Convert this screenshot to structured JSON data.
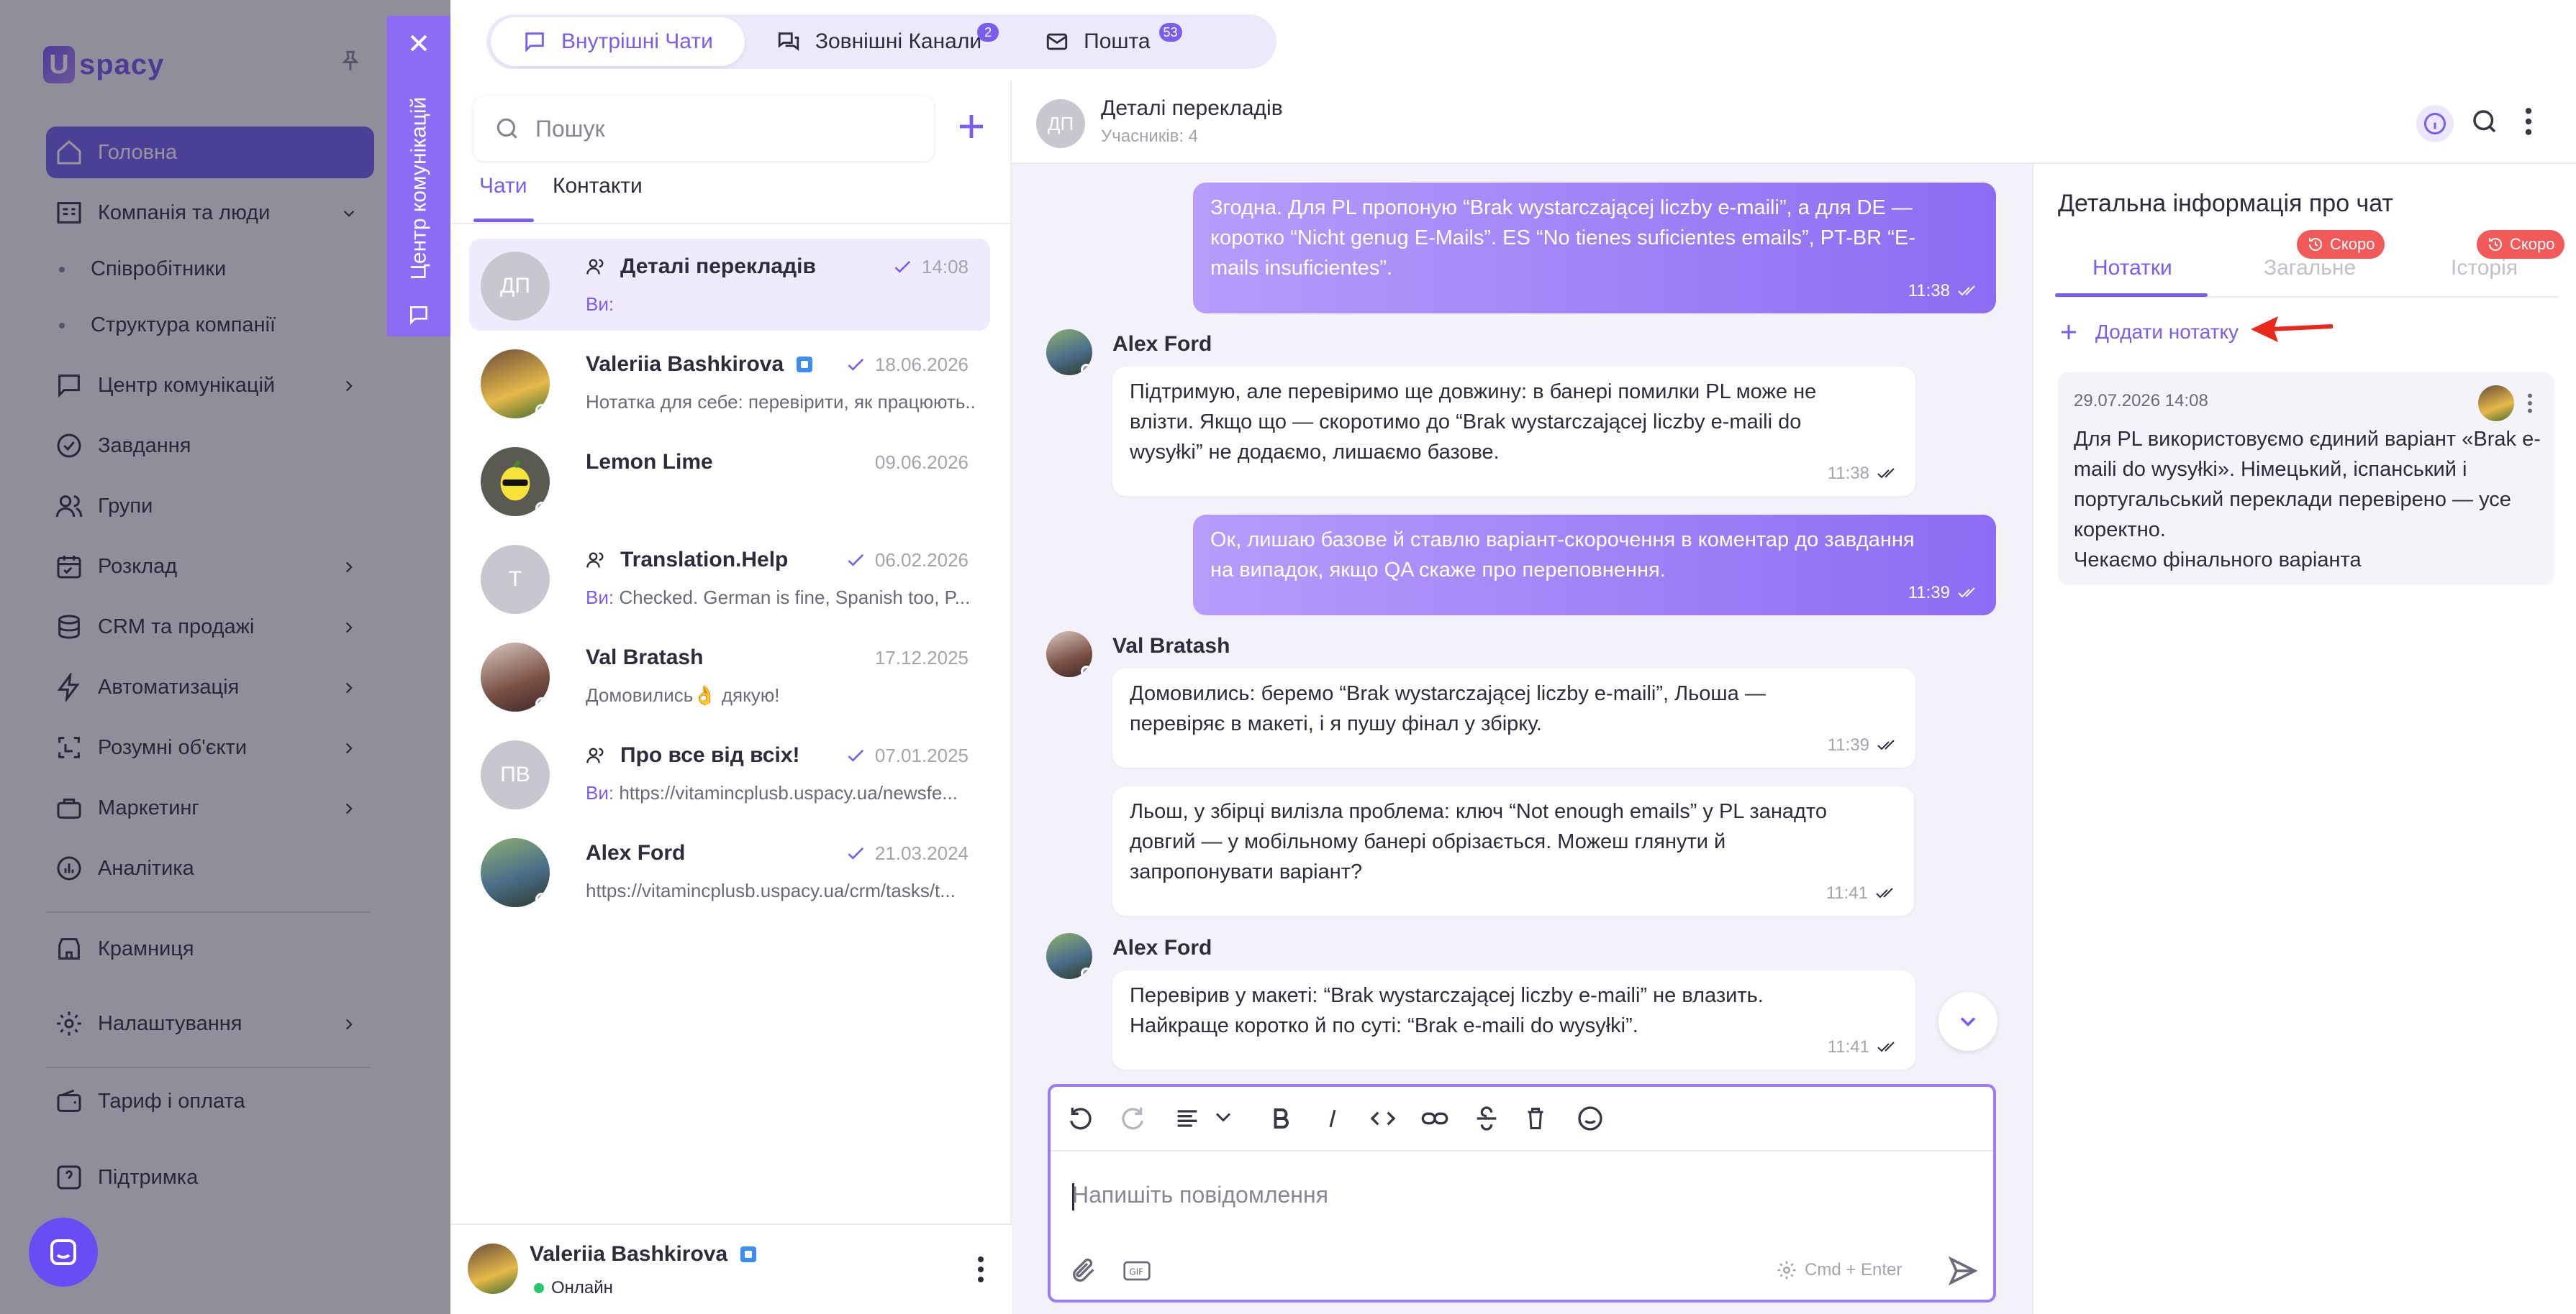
{
  "app": {
    "logo_text": "spacy",
    "logo_letter": "U"
  },
  "sidebar": {
    "items": [
      {
        "label": "Головна",
        "icon": "home-icon"
      },
      {
        "label": "Компанія та люди",
        "icon": "company-icon"
      },
      {
        "label": "Співробітники"
      },
      {
        "label": "Структура компанії"
      },
      {
        "label": "Центр комунікацій",
        "icon": "chat-icon"
      },
      {
        "label": "Завдання",
        "icon": "task-icon"
      },
      {
        "label": "Групи",
        "icon": "group-icon"
      },
      {
        "label": "Розклад",
        "icon": "calendar-icon"
      },
      {
        "label": "CRM та продажі",
        "icon": "crm-icon"
      },
      {
        "label": "Автоматизація",
        "icon": "lightning-icon"
      },
      {
        "label": "Розумні об'єкти",
        "icon": "smart-object-icon"
      },
      {
        "label": "Маркетинг",
        "icon": "marketing-icon"
      },
      {
        "label": "Аналітика",
        "icon": "analytics-icon"
      },
      {
        "label": "Крамниця",
        "icon": "store-icon"
      },
      {
        "label": "Налаштування",
        "icon": "settings-icon"
      },
      {
        "label": "Тариф і оплата",
        "icon": "wallet-icon"
      },
      {
        "label": "Підтримка",
        "icon": "support-icon"
      }
    ]
  },
  "comm_center": {
    "label": "Центр комунікацій"
  },
  "top_tabs": [
    {
      "label": "Внутрішні Чати",
      "badge": ""
    },
    {
      "label": "Зовнішні Канали",
      "badge": "2"
    },
    {
      "label": "Пошта",
      "badge": "53"
    }
  ],
  "chat_list": {
    "search_placeholder": "Пошук",
    "tabs": [
      "Чати",
      "Контакти"
    ],
    "items": [
      {
        "initials": "ДП",
        "name": "Деталі перекладів",
        "date": "14:08",
        "you": "Ви:",
        "preview": ""
      },
      {
        "initials": "",
        "name": "Valeriia Bashkirova",
        "date": "18.06.2026",
        "you": "",
        "preview": "Нотатка для себе: перевірити, як працюють..."
      },
      {
        "initials": "",
        "name": "Lemon Lime",
        "date": "09.06.2026",
        "you": "",
        "preview": ""
      },
      {
        "initials": "T",
        "name": "Translation.Help",
        "date": "06.02.2026",
        "you": "Ви:",
        "preview": "Checked. German is fine, Spanish too, P..."
      },
      {
        "initials": "",
        "name": "Val Bratash",
        "date": "17.12.2025",
        "you": "",
        "preview": "Домовились👌 дякую!"
      },
      {
        "initials": "ПВ",
        "name": "Про все від всіх!",
        "date": "07.01.2025",
        "you": "Ви:",
        "preview": "https://vitamincplusb.uspacy.ua/newsfe..."
      },
      {
        "initials": "",
        "name": "Alex Ford",
        "date": "21.03.2024",
        "you": "",
        "preview": "https://vitamincplusb.uspacy.ua/crm/tasks/t..."
      }
    ],
    "me": {
      "name": "Valeriia Bashkirova",
      "status": "Онлайн"
    }
  },
  "chat": {
    "avatar_initials": "ДП",
    "title": "Деталі перекладів",
    "subtitle": "Учасників: 4",
    "messages": [
      {
        "type": "out",
        "text": "Згодна. Для PL пропоную “Brak wystarczającej liczby e-maili”, а для DE — коротко “Nicht genug E-Mails”. ES “No tienes suficientes emails”, PT-BR “E-mails insuficientes”.",
        "time": "11:38"
      },
      {
        "type": "in",
        "sender": "Alex Ford",
        "text": "Підтримую, але перевіримо ще довжину: в банері помилки PL може не влізти. Якщо що — скоротимо до “Brak wystarczającej liczby e-maili do wysyłki” не додаємо, лишаємо базове.",
        "time": "11:38"
      },
      {
        "type": "out",
        "text": "Ок, лишаю базове й ставлю варіант-скорочення в коментар до завдання на випадок, якщо QA скаже про переповнення.",
        "time": "11:39"
      },
      {
        "type": "in",
        "sender": "Val Bratash",
        "text": "Домовились: беремо “Brak wystarczającej liczby e-maili”, Льоша — перевіряє в макеті, і я пушу фінал у збірку.",
        "time": "11:39"
      },
      {
        "type": "in",
        "sender": "",
        "text": "Льош, у збірці вилізла проблема: ключ “Not enough emails” у PL занадто довгий — у мобільному банері обрізається. Можеш глянути й запропонувати варіант?",
        "time": "11:41"
      },
      {
        "type": "in",
        "sender": "Alex Ford",
        "text": "Перевірив у макеті: “Brak wystarczającej liczby e-maili” не влазить. Найкраще коротко й по суті: “Brak e-maili do wysyłki”.",
        "time": "11:41"
      }
    ],
    "composer_placeholder": "Напишіть повідомлення",
    "send_hint": "Cmd + Enter"
  },
  "details": {
    "title": "Детальна інформація про чат",
    "tabs": [
      "Нотатки",
      "Загальне",
      "Історія"
    ],
    "soon_label": "Скоро",
    "add_note": "Додати нотатку",
    "note": {
      "date": "29.07.2026 14:08",
      "text": "Для PL використовуємо єдиний варіант «Brak e-maili do wysyłki». Німецький, іспанський і португальський переклади перевірено — усе коректно.\nЧекаємо фінального варіанта"
    }
  },
  "colors": {
    "accent": "#7B5CF0",
    "annotation_arrow": "#E8291C",
    "soon_badge": "#F25A5A",
    "online": "#28C76F"
  }
}
